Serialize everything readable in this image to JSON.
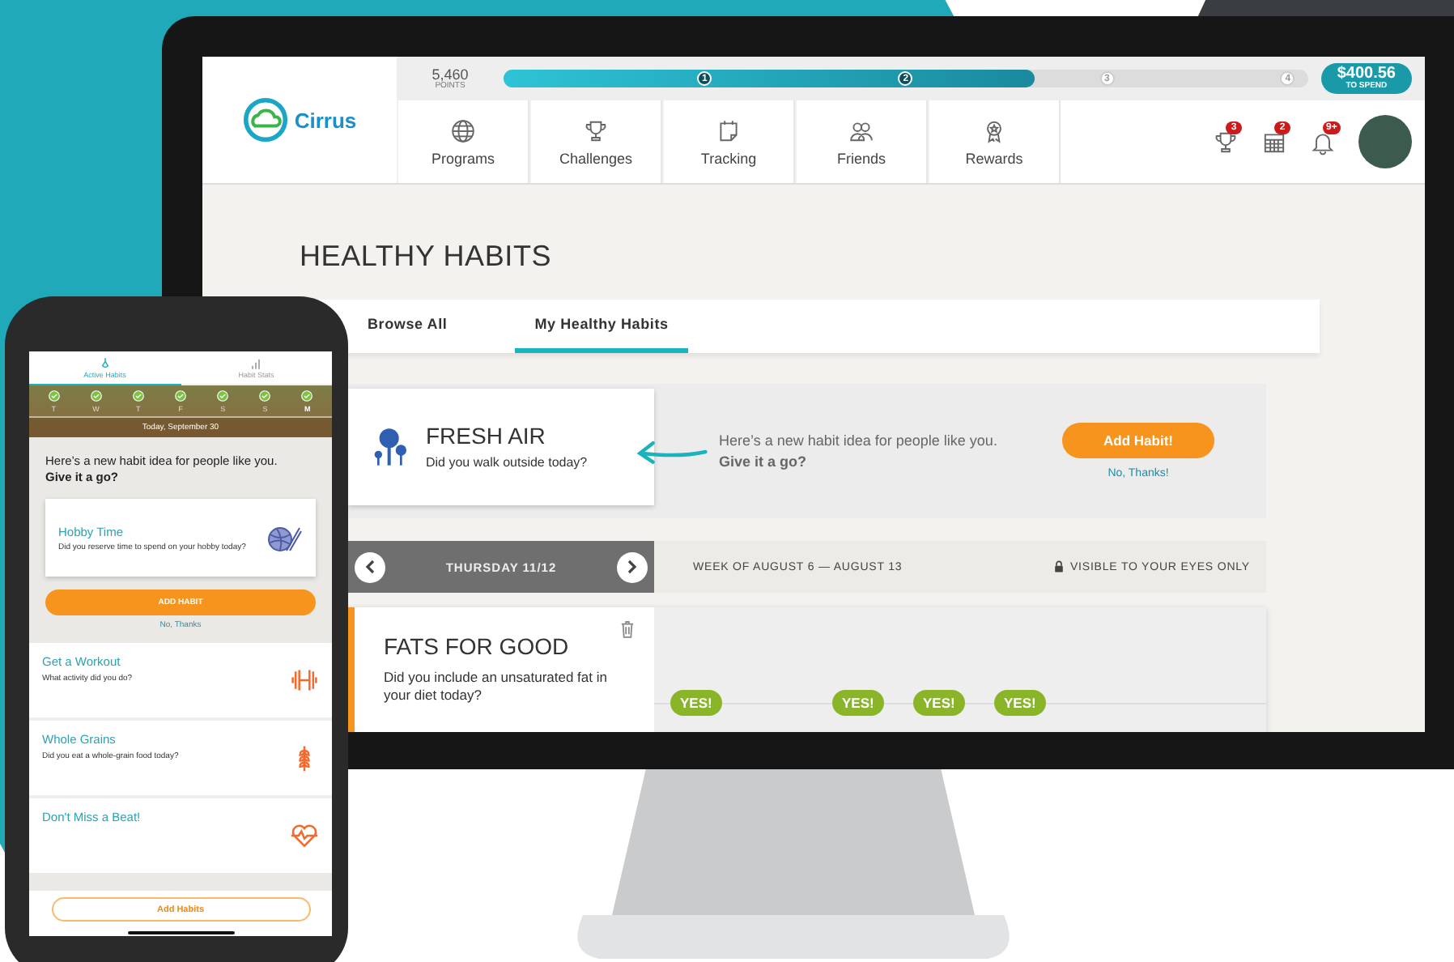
{
  "desktop": {
    "brand": "Cirrus",
    "points": {
      "value": "5,460",
      "label": "POINTS"
    },
    "progress": {
      "level": 0.66,
      "steps": [
        {
          "label": "1",
          "reached": true
        },
        {
          "label": "2",
          "reached": true
        },
        {
          "label": "3",
          "reached": false
        },
        {
          "label": "4",
          "reached": false
        }
      ]
    },
    "balance": {
      "amount": "$400.56",
      "label": "TO SPEND"
    },
    "nav": [
      {
        "label": "Programs",
        "kind": "globe"
      },
      {
        "label": "Challenges",
        "kind": "trophy"
      },
      {
        "label": "Tracking",
        "kind": "note"
      },
      {
        "label": "Friends",
        "kind": "people"
      },
      {
        "label": "Rewards",
        "kind": "medal"
      }
    ],
    "alerts": [
      {
        "kind": "trophy",
        "badge": "3"
      },
      {
        "kind": "calendar",
        "badge": "2"
      },
      {
        "kind": "bell",
        "badge": "9+"
      }
    ],
    "page_title": "HEALTHY HABITS",
    "tabs": [
      {
        "label": "Browse All",
        "selected": false
      },
      {
        "label": "My Healthy Habits",
        "selected": true
      }
    ],
    "suggestion": {
      "title": "FRESH AIR",
      "question": "Did you walk outside today?",
      "message": "Here’s a new habit idea for people like you. **Give it a go?**",
      "add_button": "Add Habit!",
      "dismiss": "No, Thanks!"
    },
    "date": "THURSDAY 11/12",
    "week": "WEEK OF AUGUST 6 — AUGUST 13",
    "privacy": "VISIBLE TO YOUR EYES ONLY",
    "habit": {
      "title": "FATS FOR GOOD",
      "question": "Did you include an unsaturated fat in your diet today?",
      "days": [
        {
          "checked": true,
          "label": "YES!"
        },
        {
          "checked": false
        },
        {
          "checked": true,
          "label": "YES!"
        },
        {
          "checked": true,
          "label": "YES!"
        },
        {
          "checked": true,
          "label": "YES!"
        },
        {
          "checked": false
        },
        {
          "checked": false
        }
      ]
    }
  },
  "phone": {
    "tabs": [
      {
        "label": "Active Habits",
        "kind": "drop",
        "selected": true
      },
      {
        "label": "Habit Stats",
        "kind": "bars",
        "selected": false
      }
    ],
    "days": [
      {
        "label": "T",
        "checked": true,
        "selected": false
      },
      {
        "label": "W",
        "checked": true,
        "selected": false
      },
      {
        "label": "T",
        "checked": true,
        "selected": false
      },
      {
        "label": "F",
        "checked": true,
        "selected": false
      },
      {
        "label": "S",
        "checked": true,
        "selected": false
      },
      {
        "label": "S",
        "checked": true,
        "selected": false
      },
      {
        "label": "M",
        "checked": true,
        "selected": true
      }
    ],
    "today": "Today, September 30",
    "prompt": "Here’s a new habit idea for people like you. **Give it a go?**",
    "suggestion": {
      "title": "Hobby Time",
      "question": "Did you reserve time to spend on your hobby today?",
      "button": "ADD HABIT",
      "dismiss": "No, Thanks"
    },
    "habits": [
      {
        "title": "Get a Workout",
        "question": "What activity did you do?",
        "kind": "dumbbell"
      },
      {
        "title": "Whole Grains",
        "question": "Did you eat a whole-grain food today?",
        "kind": "wheat"
      },
      {
        "title": "Don't Miss a Beat!",
        "kind": "heart"
      }
    ],
    "add_button": "Add Habits"
  }
}
